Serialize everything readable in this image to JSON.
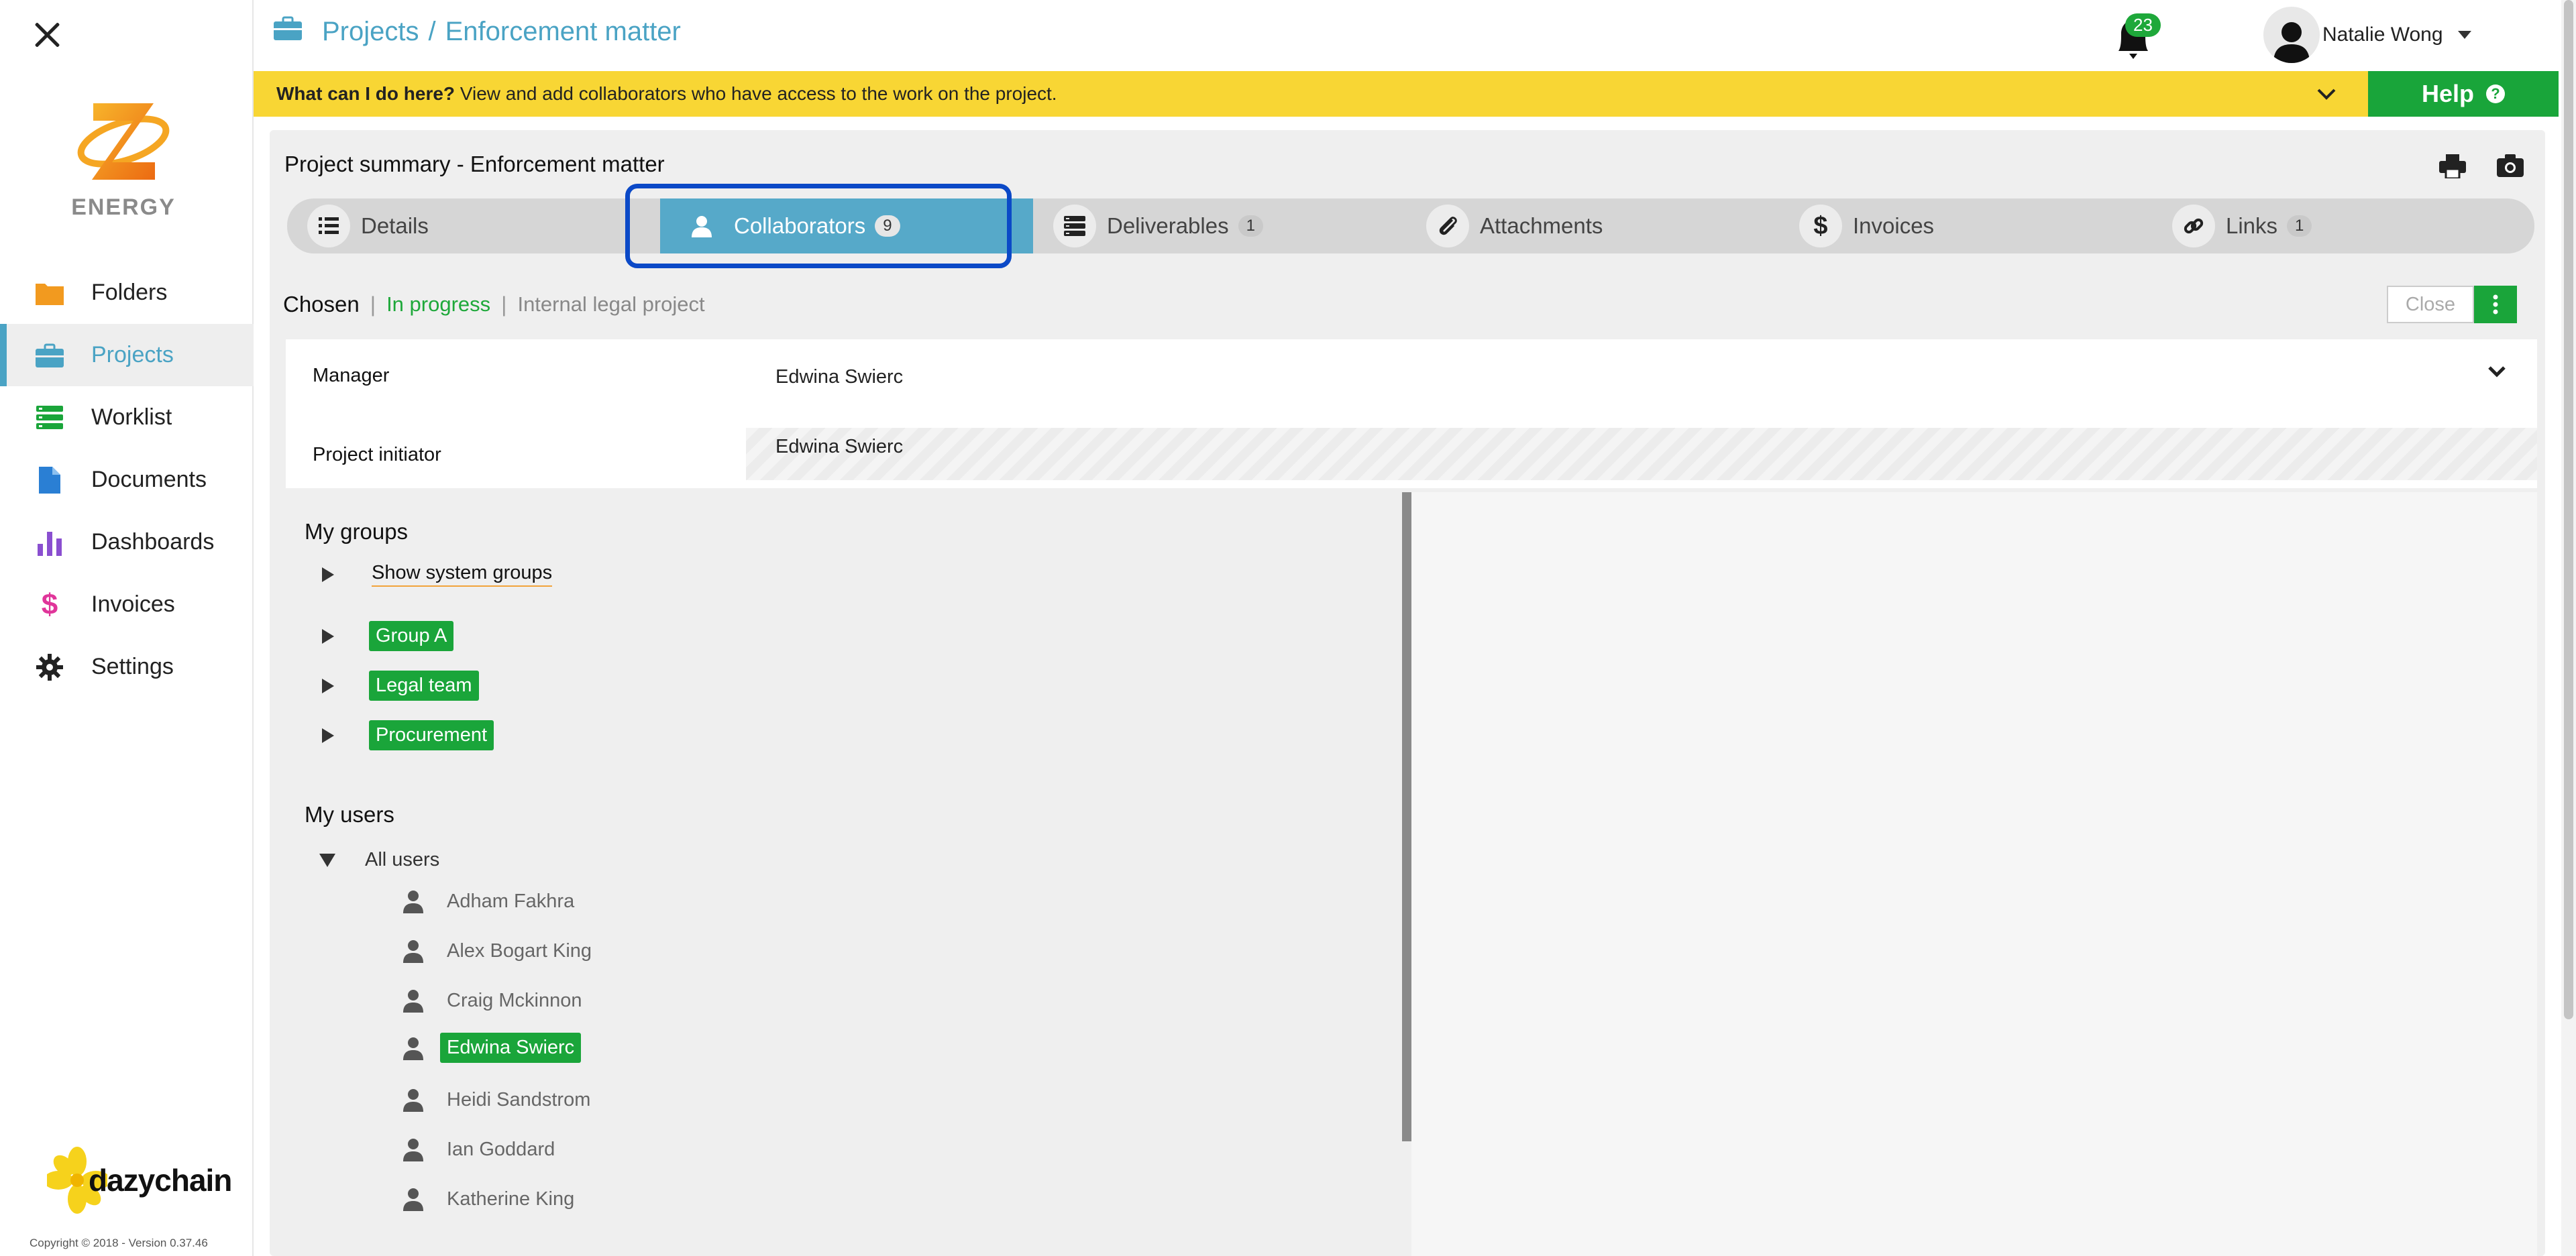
{
  "header": {
    "breadcrumb": [
      "Projects",
      "Enforcement matter"
    ],
    "breadcrumb_separator": "/",
    "notifications_count": "23",
    "user_name": "Natalie Wong"
  },
  "sidebar": {
    "brand_name": "ENERGY",
    "items": [
      {
        "label": "Folders",
        "icon": "folder-icon",
        "color": "#f29a1f"
      },
      {
        "label": "Projects",
        "icon": "briefcase-icon",
        "color": "#4aa3c4",
        "active": true
      },
      {
        "label": "Worklist",
        "icon": "list-icon",
        "color": "#1aa53a"
      },
      {
        "label": "Documents",
        "icon": "document-icon",
        "color": "#2a7fd4"
      },
      {
        "label": "Dashboards",
        "icon": "bar-chart-icon",
        "color": "#8a4fd0"
      },
      {
        "label": "Invoices",
        "icon": "dollar-icon",
        "color": "#e0359a"
      },
      {
        "label": "Settings",
        "icon": "gear-icon",
        "color": "#222222"
      }
    ],
    "footer_logo": "dazychain",
    "copyright": "Copyright © 2018 - Version 0.37.46"
  },
  "helpbar": {
    "question": "What can I do here?",
    "text": " View and add collaborators who have access to the work on the project.",
    "button_label": "Help"
  },
  "panel": {
    "title": "Project summary - Enforcement matter",
    "tabs": [
      {
        "label": "Details",
        "icon": "list-icon",
        "count": null
      },
      {
        "label": "Collaborators",
        "icon": "person-icon",
        "count": "9",
        "active": true
      },
      {
        "label": "Deliverables",
        "icon": "stack-icon",
        "count": "1"
      },
      {
        "label": "Attachments",
        "icon": "paperclip-icon",
        "count": null
      },
      {
        "label": "Invoices",
        "icon": "dollar-icon",
        "count": null
      },
      {
        "label": "Links",
        "icon": "link-icon",
        "count": "1"
      }
    ],
    "status": {
      "chosen": "Chosen",
      "state": "In progress",
      "type": "Internal legal project",
      "separator": "|",
      "close_label": "Close"
    },
    "fields": {
      "manager_label": "Manager",
      "manager_value": "Edwina Swierc",
      "initiator_label": "Project initiator",
      "initiator_value": "Edwina Swierc"
    },
    "groups": {
      "title": "My groups",
      "show_system": "Show system groups",
      "items": [
        "Group A",
        "Legal team",
        "Procurement"
      ]
    },
    "users": {
      "title": "My users",
      "all_label": "All users",
      "items": [
        "Adham Fakhra",
        "Alex Bogart King",
        "Craig Mckinnon",
        "Edwina Swierc",
        "Heidi Sandstrom",
        "Ian Goddard",
        "Katherine King"
      ],
      "selected": "Edwina Swierc"
    }
  },
  "colors": {
    "accent": "#4aa3c4",
    "green": "#1aa53a",
    "help_yellow": "#f8d634",
    "highlight_blue": "#0b49c7"
  }
}
